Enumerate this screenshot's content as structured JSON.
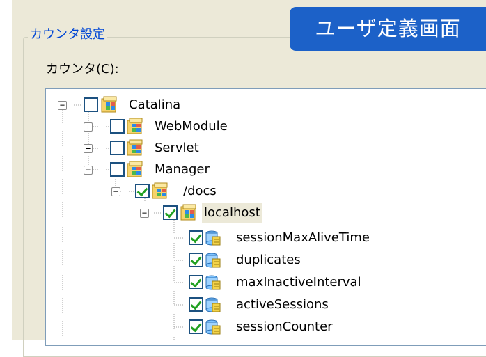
{
  "banner": {
    "text": "ユーザ定義画面"
  },
  "group": {
    "legend": "カウンタ設定"
  },
  "counter": {
    "label_prefix": "カウンタ(",
    "label_key": "C",
    "label_suffix": "):"
  },
  "tree": {
    "nodes": [
      {
        "label": "Catalina",
        "expander": "−",
        "checked": false,
        "icon": "folder-icon"
      },
      {
        "label": "WebModule",
        "expander": "+",
        "checked": false,
        "icon": "folder-icon"
      },
      {
        "label": "Servlet",
        "expander": "+",
        "checked": false,
        "icon": "folder-icon"
      },
      {
        "label": "Manager",
        "expander": "−",
        "checked": false,
        "icon": "folder-icon"
      },
      {
        "label": "/docs",
        "expander": "−",
        "checked": true,
        "icon": "folder-icon"
      },
      {
        "label": "localhost",
        "expander": "−",
        "checked": true,
        "icon": "folder-icon",
        "selected": true
      },
      {
        "label": "sessionMaxAliveTime",
        "checked": true,
        "icon": "counter-icon"
      },
      {
        "label": "duplicates",
        "checked": true,
        "icon": "counter-icon"
      },
      {
        "label": "maxInactiveInterval",
        "checked": true,
        "icon": "counter-icon"
      },
      {
        "label": "activeSessions",
        "checked": true,
        "icon": "counter-icon"
      },
      {
        "label": "sessionCounter",
        "checked": true,
        "icon": "counter-icon"
      }
    ]
  },
  "colors": {
    "banner_bg": "#1c61c8",
    "legend_text": "#0046d5",
    "dialog_bg": "#ece9d8",
    "check_green": "#21a121",
    "checkbox_border": "#1c5180"
  }
}
